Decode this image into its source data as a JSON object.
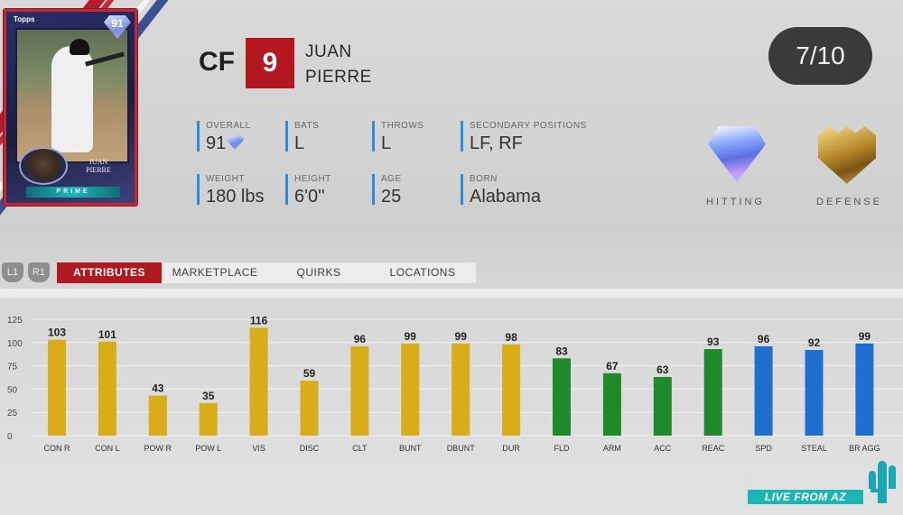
{
  "card": {
    "rating": "91",
    "brand": "Topps",
    "name_line1": "JUAN",
    "name_line2": "PIERRE",
    "series": "PRIME"
  },
  "player": {
    "position": "CF",
    "number": "9",
    "first_name": "JUAN",
    "last_name": "PIERRE"
  },
  "counter": "7/10",
  "stats": {
    "overall": {
      "label": "OVERALL",
      "value": "91"
    },
    "bats": {
      "label": "BATS",
      "value": "L"
    },
    "throws": {
      "label": "THROWS",
      "value": "L"
    },
    "secondary": {
      "label": "SECONDARY POSITIONS",
      "value": "LF, RF"
    },
    "weight": {
      "label": "WEIGHT",
      "value": "180 lbs"
    },
    "height": {
      "label": "HEIGHT",
      "value": "6'0''"
    },
    "age": {
      "label": "AGE",
      "value": "25"
    },
    "born": {
      "label": "BORN",
      "value": "Alabama"
    }
  },
  "badges": {
    "hitting": "HITTING",
    "defense": "DEFENSE"
  },
  "nav": {
    "l1": "L1",
    "r1": "R1",
    "tabs": [
      "ATTRIBUTES",
      "MARKETPLACE",
      "QUIRKS",
      "LOCATIONS"
    ]
  },
  "watermark": "LIVE FROM AZ",
  "colors": {
    "hitting": "#d8ad18",
    "fielding": "#1f8a2a",
    "running": "#1f6fd0",
    "accent": "#b01822",
    "stat_bar": "#2a8ee0"
  },
  "chart_data": {
    "type": "bar",
    "ylim": [
      0,
      125
    ],
    "yticks": [
      0,
      25,
      50,
      75,
      100,
      125
    ],
    "grid": true,
    "categories": [
      "CON R",
      "CON L",
      "POW R",
      "POW L",
      "VIS",
      "DISC",
      "CLT",
      "BUNT",
      "DBUNT",
      "DUR",
      "FLD",
      "ARM",
      "ACC",
      "REAC",
      "SPD",
      "STEAL",
      "BR AGG"
    ],
    "values": [
      103,
      101,
      43,
      35,
      116,
      59,
      96,
      99,
      99,
      98,
      83,
      67,
      63,
      93,
      96,
      92,
      99
    ],
    "groups": [
      "hitting",
      "hitting",
      "hitting",
      "hitting",
      "hitting",
      "hitting",
      "hitting",
      "hitting",
      "hitting",
      "hitting",
      "fielding",
      "fielding",
      "fielding",
      "fielding",
      "running",
      "running",
      "running"
    ]
  }
}
